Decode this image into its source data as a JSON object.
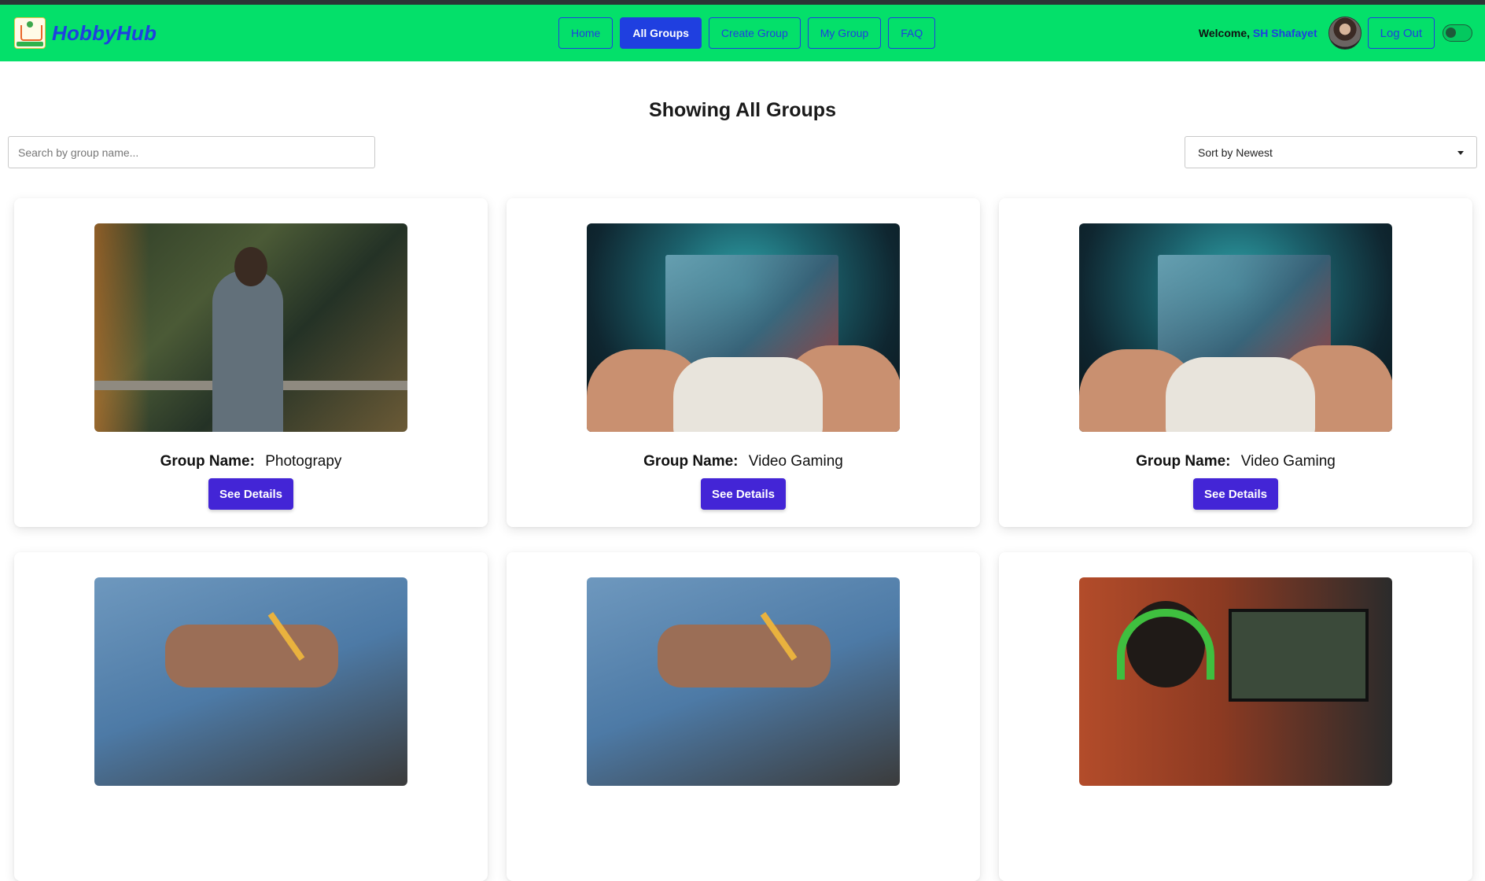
{
  "navbar": {
    "brand": {
      "name": "HobbyHub",
      "logo_text": "HOBBY HUB"
    },
    "links": [
      {
        "label": "Home",
        "active": false
      },
      {
        "label": "All Groups",
        "active": true
      },
      {
        "label": "Create Group",
        "active": false
      },
      {
        "label": "My Group",
        "active": false
      },
      {
        "label": "FAQ",
        "active": false
      }
    ],
    "welcome_prefix": "Welcome,",
    "user_name": "SH Shafayet",
    "logout_label": "Log Out",
    "theme_toggle": "off"
  },
  "page": {
    "title": "Showing All Groups",
    "search_placeholder": "Search by group name...",
    "sort_value": "Sort by Newest"
  },
  "groups": [
    {
      "label": "Group Name:",
      "name": "Photograpy",
      "image": "photography-image",
      "button": "See Details"
    },
    {
      "label": "Group Name:",
      "name": "Video Gaming",
      "image": "gaming-controller-image",
      "button": "See Details"
    },
    {
      "label": "Group Name:",
      "name": "Video Gaming",
      "image": "gaming-controller-image",
      "button": "See Details"
    },
    {
      "label": "",
      "name": "",
      "image": "writing-image",
      "button": ""
    },
    {
      "label": "",
      "name": "",
      "image": "writing-image",
      "button": ""
    },
    {
      "label": "",
      "name": "",
      "image": "pc-gamer-headphones-image",
      "button": ""
    }
  ],
  "colors": {
    "navbar_bg": "#04e06a",
    "accent_blue": "#1f3fe0",
    "button_purple": "#4325d6"
  }
}
